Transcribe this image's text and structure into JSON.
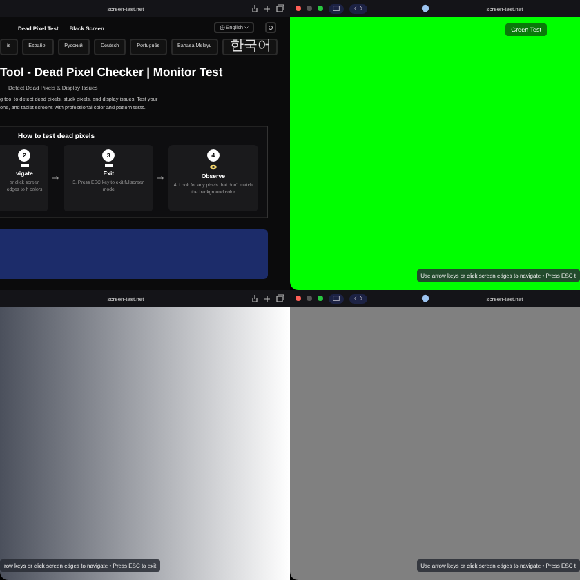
{
  "panels": [
    {
      "kind": "site",
      "color": "#0b0b0c",
      "browser": {
        "url": "screen-test.net",
        "traffic_lights": false
      },
      "nav": [
        "Dead Pixel Test",
        "Black Screen"
      ],
      "language": "English",
      "languages": [
        {
          "label": "is",
          "kind": "latin"
        },
        {
          "label": "Español",
          "kind": "latin"
        },
        {
          "label": "Русский",
          "kind": "latin"
        },
        {
          "label": "Deutsch",
          "kind": "latin"
        },
        {
          "label": "Português",
          "kind": "latin"
        },
        {
          "label": "Bahasa Melayu",
          "kind": "latin"
        },
        {
          "label": "한국어",
          "kind": "hangul"
        }
      ],
      "title": "Tool - Dead Pixel Checker | Monitor Test",
      "subtitle": "Detect Dead Pixels & Display Issues",
      "intro": [
        "g tool to detect dead pixels, stuck pixels, and display issues. Test your",
        "one, and tablet screens with professional color and pattern tests."
      ],
      "howto": {
        "title": "How to test dead pixels",
        "steps": [
          {
            "number": "2",
            "title": "vigate",
            "text": "or click screen edges to h colors",
            "cut": true
          },
          {
            "number": "3",
            "title": "Exit",
            "text": "3. Press ESC key to exit fullscreen mode",
            "cut": false
          },
          {
            "number": "4",
            "title": "Observe",
            "text": "4. Look for any pixels that don't match the background color",
            "cut": false
          }
        ]
      }
    },
    {
      "kind": "solid",
      "color": "#00ff00",
      "browser": {
        "url": "screen-test.net",
        "traffic_lights": true
      },
      "badge": "Green Test",
      "hint": "Use arrow keys or click screen edges to navigate • Press ESC t"
    },
    {
      "kind": "gradient",
      "color": "#4b505c",
      "browser": {
        "url": "screen-test.net",
        "traffic_lights": false
      },
      "hint": "row keys or click screen edges to navigate • Press ESC to exit"
    },
    {
      "kind": "solid",
      "color": "#808080",
      "browser": {
        "url": "screen-test.net",
        "traffic_lights": true
      },
      "hint": "Use arrow keys or click screen edges to navigate • Press ESC t"
    }
  ]
}
